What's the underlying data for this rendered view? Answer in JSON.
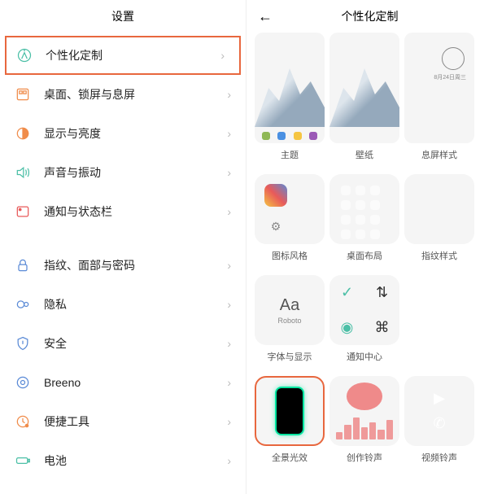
{
  "left": {
    "title": "设置",
    "items": [
      {
        "label": "个性化定制",
        "highlighted": true
      },
      {
        "label": "桌面、锁屏与息屏"
      },
      {
        "label": "显示与亮度"
      },
      {
        "label": "声音与振动"
      },
      {
        "label": "通知与状态栏"
      },
      {
        "label": "指纹、面部与密码"
      },
      {
        "label": "隐私"
      },
      {
        "label": "安全"
      },
      {
        "label": "Breeno"
      },
      {
        "label": "便捷工具"
      },
      {
        "label": "电池"
      }
    ]
  },
  "right": {
    "title": "个性化定制",
    "tiles": {
      "theme": "主题",
      "wallpaper": "壁纸",
      "aod": "息屏样式",
      "iconstyle": "图标风格",
      "layout": "桌面布局",
      "fingerprint": "指纹样式",
      "font": "字体与显示",
      "font_sample": "Aa",
      "font_name": "Roboto",
      "notif": "通知中心",
      "glow": "全景光效",
      "ring": "创作铃声",
      "video": "视频铃声"
    },
    "aod_text": "8月24日周三"
  }
}
